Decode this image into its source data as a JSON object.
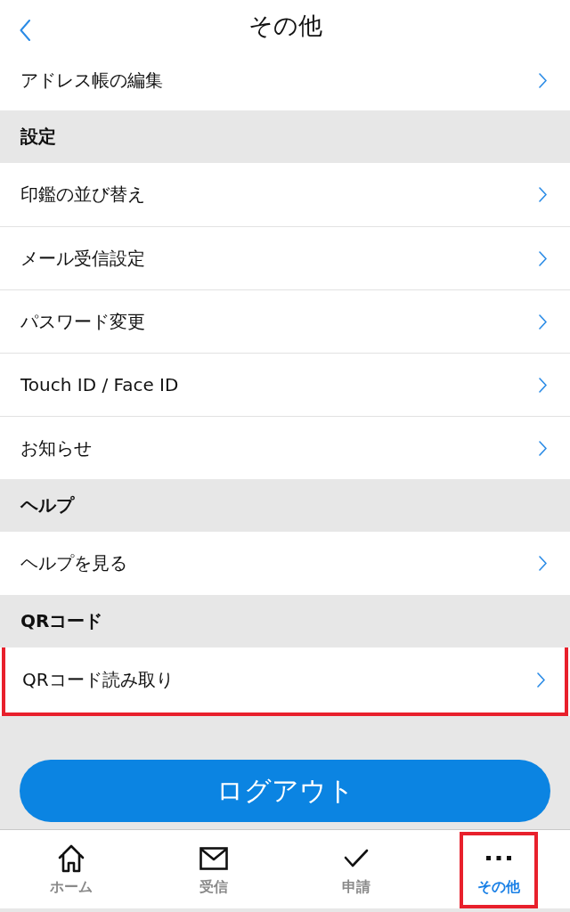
{
  "header": {
    "title": "その他"
  },
  "sections": [
    {
      "items": [
        {
          "label": "アドレス帳の編集",
          "highlighted": false
        }
      ]
    },
    {
      "title": "設定",
      "items": [
        {
          "label": "印鑑の並び替え",
          "highlighted": false
        },
        {
          "label": "メール受信設定",
          "highlighted": false
        },
        {
          "label": "パスワード変更",
          "highlighted": false
        },
        {
          "label": "Touch ID / Face ID",
          "highlighted": false
        },
        {
          "label": "お知らせ",
          "highlighted": false
        }
      ]
    },
    {
      "title": "ヘルプ",
      "items": [
        {
          "label": "ヘルプを見る",
          "highlighted": false
        }
      ]
    },
    {
      "title": "QRコード",
      "items": [
        {
          "label": "QRコード読み取り",
          "highlighted": true
        }
      ]
    }
  ],
  "logout_button": {
    "label": "ログアウト"
  },
  "tab_bar": [
    {
      "label": "ホーム",
      "selected": false,
      "highlighted": false
    },
    {
      "label": "受信",
      "selected": false,
      "highlighted": false
    },
    {
      "label": "申請",
      "selected": false,
      "highlighted": false
    },
    {
      "label": "その他",
      "selected": true,
      "highlighted": true
    }
  ]
}
